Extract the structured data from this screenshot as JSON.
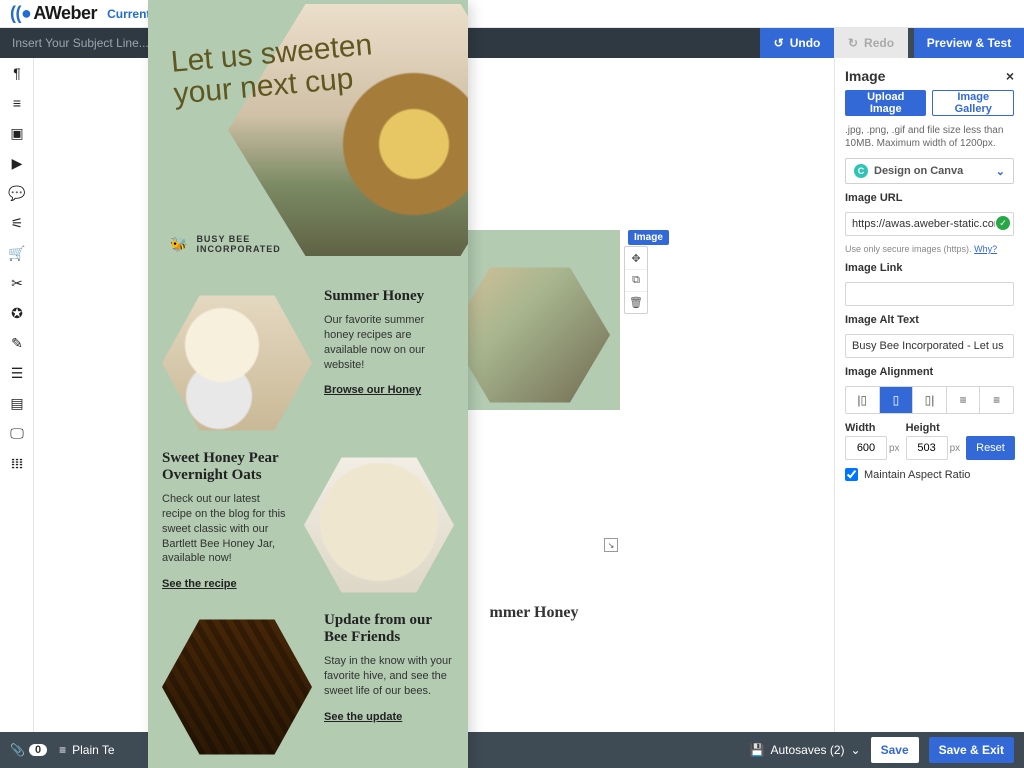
{
  "header": {
    "brand": "AWeber",
    "current_list_label": "Current List:"
  },
  "subject": {
    "placeholder": "Insert Your Subject Line..."
  },
  "actions": {
    "undo": "Undo",
    "redo": "Redo",
    "preview_test": "Preview & Test"
  },
  "block": {
    "tag": "Image"
  },
  "footer": {
    "attachment_count": "0",
    "plain_text": "Plain Te",
    "autosave": "Autosaves (2)",
    "save": "Save",
    "save_exit": "Save & Exit"
  },
  "inspector": {
    "title": "Image",
    "upload_image": "Upload Image",
    "image_gallery": "Image Gallery",
    "filetype_help": ".jpg, .png, .gif and file size less than 10MB. Maximum width of 1200px.",
    "design_canva": "Design on Canva",
    "image_url_label": "Image URL",
    "image_url_value": "https://awas.aweber-static.com/image",
    "secure_hint": "Use only secure images (https).",
    "why": "Why?",
    "image_link_label": "Image Link",
    "image_link_value": "",
    "alt_label": "Image Alt Text",
    "alt_value": "Busy Bee Incorporated - Let us sweeten yo",
    "alignment_label": "Image Alignment",
    "width_label": "Width",
    "height_label": "Height",
    "width_value": "600",
    "height_value": "503",
    "px": "px",
    "reset": "Reset",
    "maintain_aspect": "Maintain Aspect Ratio"
  },
  "email": {
    "tagline_l1": "Let us sweeten",
    "tagline_l2": "your next cup",
    "brand_l1": "BUSY BEE",
    "brand_l2": "INCORPORATED",
    "sections": [
      {
        "title": "Summer Honey",
        "body": "Our favorite summer honey recipes are available now on our website!",
        "cta": "Browse our Honey"
      },
      {
        "title": "Sweet Honey Pear Overnight Oats",
        "body": "Check out our latest recipe on the blog for this sweet classic with our Bartlett Bee Honey Jar, available now!",
        "cta": "See the recipe"
      },
      {
        "title": "Update from our Bee Friends",
        "body": "Stay in the know with your favorite hive, and see the sweet life of our bees.",
        "cta": "See the update"
      }
    ],
    "bg_section_title": "mmer Honey"
  }
}
